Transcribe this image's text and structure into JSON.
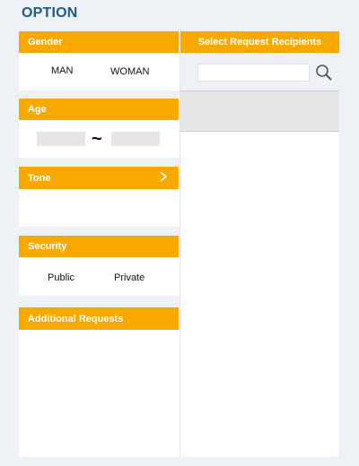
{
  "page": {
    "title": "OPTION"
  },
  "gender": {
    "header": "Gender",
    "options": [
      "MAN",
      "WOMAN"
    ]
  },
  "age": {
    "header": "Age",
    "separator": "~",
    "from_value": "",
    "to_value": ""
  },
  "tone": {
    "header": "Tone",
    "arrow_icon": "chevron-right-icon"
  },
  "security": {
    "header": "Security",
    "options": [
      "Public",
      "Private"
    ]
  },
  "additional": {
    "header": "Additional Requests"
  },
  "recipients": {
    "header": "Select Request Recipients",
    "search": {
      "value": "",
      "placeholder": ""
    },
    "search_icon": "search-icon"
  },
  "colors": {
    "accent": "#f8a900",
    "title": "#1f5a8a",
    "background": "#eef2f6",
    "panel": "#ffffff",
    "selected_bar": "#e6e6e6"
  }
}
